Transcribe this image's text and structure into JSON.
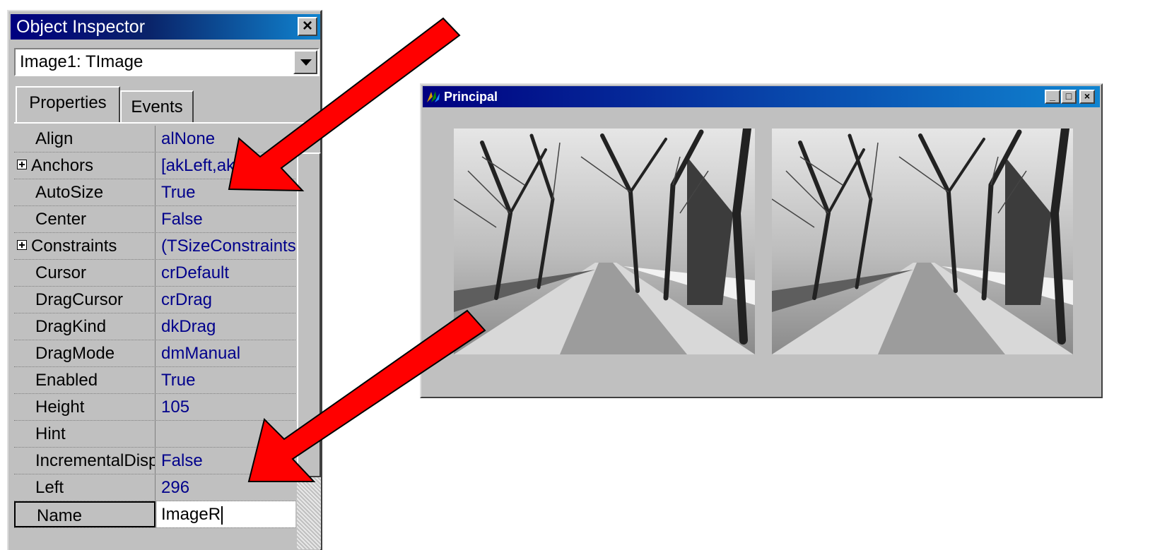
{
  "object_inspector": {
    "title": "Object Inspector",
    "close_glyph": "×",
    "selected_component": "Image1: TImage",
    "tabs": [
      {
        "label": "Properties",
        "active": true
      },
      {
        "label": "Events",
        "active": false
      }
    ],
    "properties": [
      {
        "name": "Align",
        "value": "alNone"
      },
      {
        "name": "Anchors",
        "value": "[akLeft,akTop]",
        "expandable": true
      },
      {
        "name": "AutoSize",
        "value": "True"
      },
      {
        "name": "Center",
        "value": "False"
      },
      {
        "name": "Constraints",
        "value": "(TSizeConstraints)",
        "expandable": true
      },
      {
        "name": "Cursor",
        "value": "crDefault"
      },
      {
        "name": "DragCursor",
        "value": "crDrag"
      },
      {
        "name": "DragKind",
        "value": "dkDrag"
      },
      {
        "name": "DragMode",
        "value": "dmManual"
      },
      {
        "name": "Enabled",
        "value": "True"
      },
      {
        "name": "Height",
        "value": "105"
      },
      {
        "name": "Hint",
        "value": ""
      },
      {
        "name": "IncrementalDisplay",
        "value": "False"
      },
      {
        "name": "Left",
        "value": "296"
      },
      {
        "name": "Name",
        "value": "ImageR",
        "selected": true
      }
    ]
  },
  "principal_window": {
    "title": "Principal",
    "buttons": {
      "minimize": "_",
      "maximize": "□",
      "close": "×"
    },
    "images": [
      {
        "description": "winter road photo"
      },
      {
        "description": "winter road photo"
      }
    ]
  },
  "colors": {
    "arrow_fill": "#ff0000",
    "title_active": "#000080",
    "value_text": "#00008b",
    "face": "#c0c0c0"
  }
}
